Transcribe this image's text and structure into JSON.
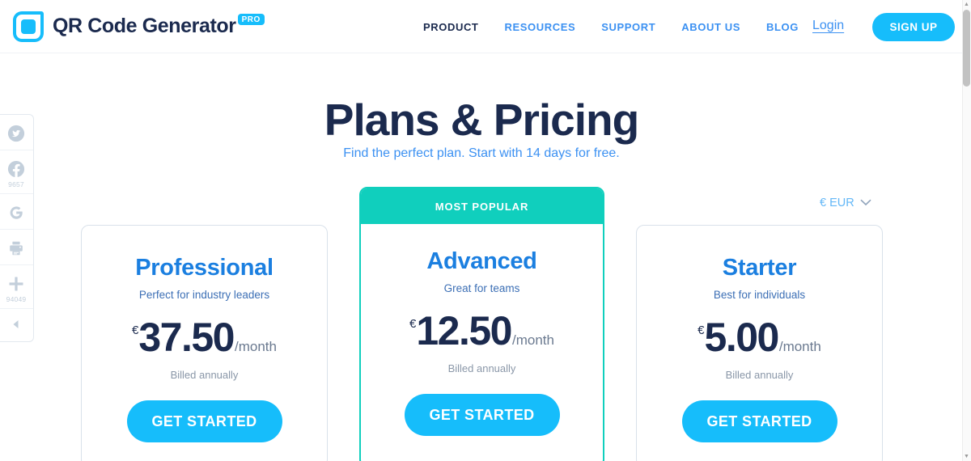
{
  "header": {
    "brand_name": "QR Code Generator",
    "brand_badge": "PRO",
    "logo_icon": "qr-code-icon",
    "nav": [
      {
        "label": "PRODUCT",
        "active": true
      },
      {
        "label": "RESOURCES",
        "active": false
      },
      {
        "label": "SUPPORT",
        "active": false
      },
      {
        "label": "ABOUT US",
        "active": false
      },
      {
        "label": "BLOG",
        "active": false
      }
    ],
    "login_label": "Login",
    "signup_label": "SIGN UP"
  },
  "social_rail": {
    "items": [
      {
        "icon": "twitter-icon",
        "count": ""
      },
      {
        "icon": "facebook-icon",
        "count": "9657"
      },
      {
        "icon": "google-icon",
        "count": ""
      },
      {
        "icon": "print-icon",
        "count": ""
      },
      {
        "icon": "plus-icon",
        "count": "94049"
      },
      {
        "icon": "collapse-left-icon",
        "count": ""
      }
    ]
  },
  "hero": {
    "title": "Plans & Pricing",
    "subtitle": "Find the perfect plan. Start with 14 days for free."
  },
  "currency": {
    "symbol": "€",
    "code": "EUR",
    "label": "€ EUR",
    "chevron_icon": "chevron-down-icon"
  },
  "plans": [
    {
      "name": "Professional",
      "tagline": "Perfect for industry leaders",
      "currency_symbol": "€",
      "price": "37.50",
      "period": "/month",
      "billing_note": "Billed annually",
      "cta_label": "GET STARTED",
      "badge": "",
      "highlighted": false
    },
    {
      "name": "Advanced",
      "tagline": "Great for teams",
      "currency_symbol": "€",
      "price": "12.50",
      "period": "/month",
      "billing_note": "Billed annually",
      "cta_label": "GET STARTED",
      "badge": "MOST POPULAR",
      "highlighted": true
    },
    {
      "name": "Starter",
      "tagline": "Best for individuals",
      "currency_symbol": "€",
      "price": "5.00",
      "period": "/month",
      "billing_note": "Billed annually",
      "cta_label": "GET STARTED",
      "badge": "",
      "highlighted": false
    }
  ],
  "colors": {
    "brand_cyan": "#16bdfb",
    "navy": "#1b2a4e",
    "link_blue": "#3c91f2",
    "plan_blue": "#1b7fe0",
    "teal": "#10cfbd",
    "card_border": "#d9e1ea"
  }
}
